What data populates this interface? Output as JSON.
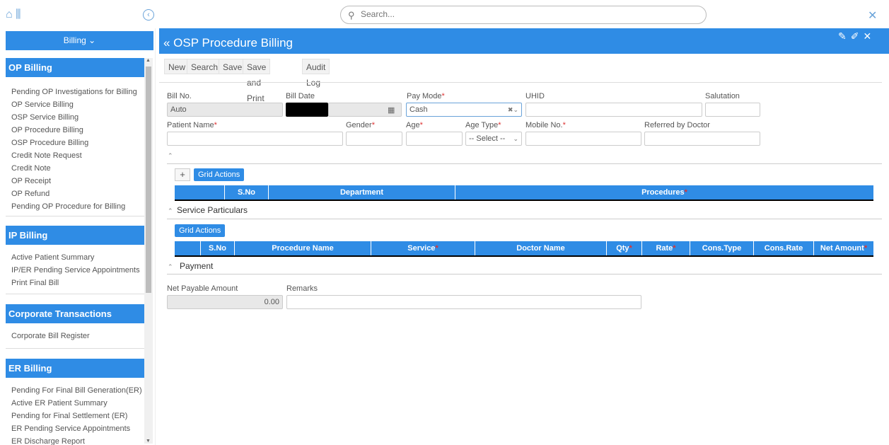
{
  "topbar": {
    "search_placeholder": "Search..."
  },
  "sidebar": {
    "module_dropdown": "Billing ⌄",
    "sections": [
      {
        "title": "OP Billing",
        "items": [
          "Pending OP Investigations for Billing",
          "OP Service Billing",
          "OSP Service Billing",
          "OP Procedure Billing",
          "OSP Procedure Billing",
          "Credit Note Request",
          "Credit Note",
          "OP Receipt",
          "OP Refund",
          "Pending OP Procedure for Billing"
        ]
      },
      {
        "title": "IP Billing",
        "items": [
          "Active Patient Summary",
          "IP/ER Pending Service Appointments",
          "Print Final Bill"
        ]
      },
      {
        "title": "Corporate Transactions",
        "items": [
          "Corporate Bill Register"
        ]
      },
      {
        "title": "ER Billing",
        "items": [
          "Pending For Final Bill Generation(ER)",
          "Active ER Patient Summary",
          "Pending for Final Settlement (ER)",
          "ER Pending Service Appointments",
          "ER Discharge Report"
        ]
      }
    ]
  },
  "main": {
    "title": "« OSP Procedure Billing",
    "toolbar": [
      "New",
      "Search",
      "Save",
      "Save and Print",
      "Audit Log"
    ],
    "form": {
      "bill_no_label": "Bill No.",
      "bill_no_value": "Auto",
      "bill_date_label": "Bill Date",
      "pay_mode_label": "Pay Mode",
      "pay_mode_value": "Cash",
      "uhid_label": "UHID",
      "salutation_label": "Salutation",
      "patient_name_label": "Patient Name",
      "gender_label": "Gender",
      "age_label": "Age",
      "age_type_label": "Age Type",
      "age_type_value": "-- Select --",
      "mobile_label": "Mobile No.",
      "referred_label": "Referred by Doctor"
    },
    "grid_actions_label": "Grid Actions",
    "procedures_grid": {
      "columns": [
        "",
        "S.No",
        "Department",
        "Procedures"
      ]
    },
    "service_particulars_title": "Service Particulars",
    "service_grid": {
      "columns": [
        "",
        "S.No",
        "Procedure Name",
        "Service",
        "Doctor Name",
        "Qty",
        "Rate",
        "Cons.Type",
        "Cons.Rate",
        "Net Amount"
      ]
    },
    "payment_title": "Payment",
    "net_payable_label": "Net Payable Amount",
    "net_payable_value": "0.00",
    "remarks_label": "Remarks"
  }
}
